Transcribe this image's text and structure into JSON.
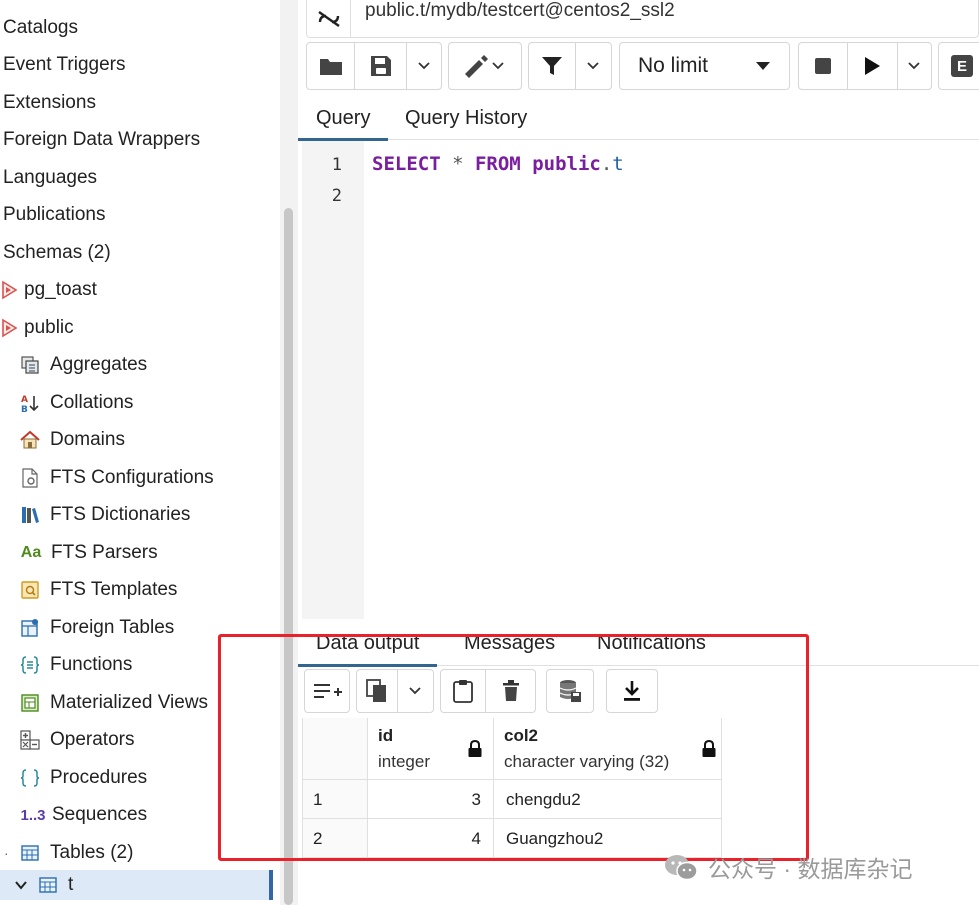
{
  "tree": {
    "items": [
      {
        "label": "Catalogs"
      },
      {
        "label": "Event Triggers"
      },
      {
        "label": "Extensions"
      },
      {
        "label": "Foreign Data Wrappers"
      },
      {
        "label": "Languages"
      },
      {
        "label": "Publications"
      },
      {
        "label": "Schemas (2)"
      },
      {
        "label": "pg_toast",
        "icon": "schema-icon"
      },
      {
        "label": "public",
        "icon": "schema-icon"
      },
      {
        "label": "Aggregates",
        "icon": "aggregates-icon"
      },
      {
        "label": "Collations",
        "icon": "collations-icon"
      },
      {
        "label": "Domains",
        "icon": "domains-icon"
      },
      {
        "label": "FTS Configurations",
        "icon": "fts-configurations-icon"
      },
      {
        "label": "FTS Dictionaries",
        "icon": "fts-dictionaries-icon"
      },
      {
        "label": "FTS Parsers",
        "icon": "fts-parsers-icon",
        "icon_text": "Aa"
      },
      {
        "label": "FTS Templates",
        "icon": "fts-templates-icon"
      },
      {
        "label": "Foreign Tables",
        "icon": "foreign-tables-icon"
      },
      {
        "label": "Functions",
        "icon": "functions-icon"
      },
      {
        "label": "Materialized Views",
        "icon": "materialized-views-icon"
      },
      {
        "label": "Operators",
        "icon": "operators-icon"
      },
      {
        "label": "Procedures",
        "icon": "procedures-icon"
      },
      {
        "label": "Sequences",
        "icon": "sequences-icon",
        "icon_text": "1..3"
      },
      {
        "label": "Tables (2)",
        "icon": "tables-icon"
      },
      {
        "label": "t",
        "icon": "table-icon",
        "selected": true
      }
    ]
  },
  "connection": {
    "title": "public.t/mydb/testcert@centos2_ssl2"
  },
  "toolbar": {
    "limit_label": "No limit",
    "partial_letter": "E"
  },
  "query_tabs": [
    {
      "label": "Query",
      "active": true
    },
    {
      "label": "Query History",
      "active": false
    }
  ],
  "editor": {
    "line_numbers": [
      "1",
      "2"
    ],
    "tokens": {
      "kw1": "SELECT",
      "star": " * ",
      "kw2": "FROM",
      "schema": "public",
      "dot": ".",
      "table": "t"
    }
  },
  "result_tabs": [
    {
      "label": "Data output",
      "active": true
    },
    {
      "label": "Messages",
      "active": false
    },
    {
      "label": "Notifications",
      "active": false
    }
  ],
  "grid": {
    "columns": [
      {
        "name": "id",
        "type": "integer"
      },
      {
        "name": "col2",
        "type": "character varying (32)"
      }
    ],
    "rows": [
      {
        "num": "1",
        "id": "3",
        "col2": "chengdu2"
      },
      {
        "num": "2",
        "id": "4",
        "col2": "Guangzhou2"
      }
    ]
  },
  "watermark": {
    "text": "公众号 · 数据库杂记"
  },
  "colors": {
    "accent": "#326690",
    "highlight": "#e8212b",
    "keyword": "#7a1ea0",
    "identifier": "#1f5fa8"
  }
}
